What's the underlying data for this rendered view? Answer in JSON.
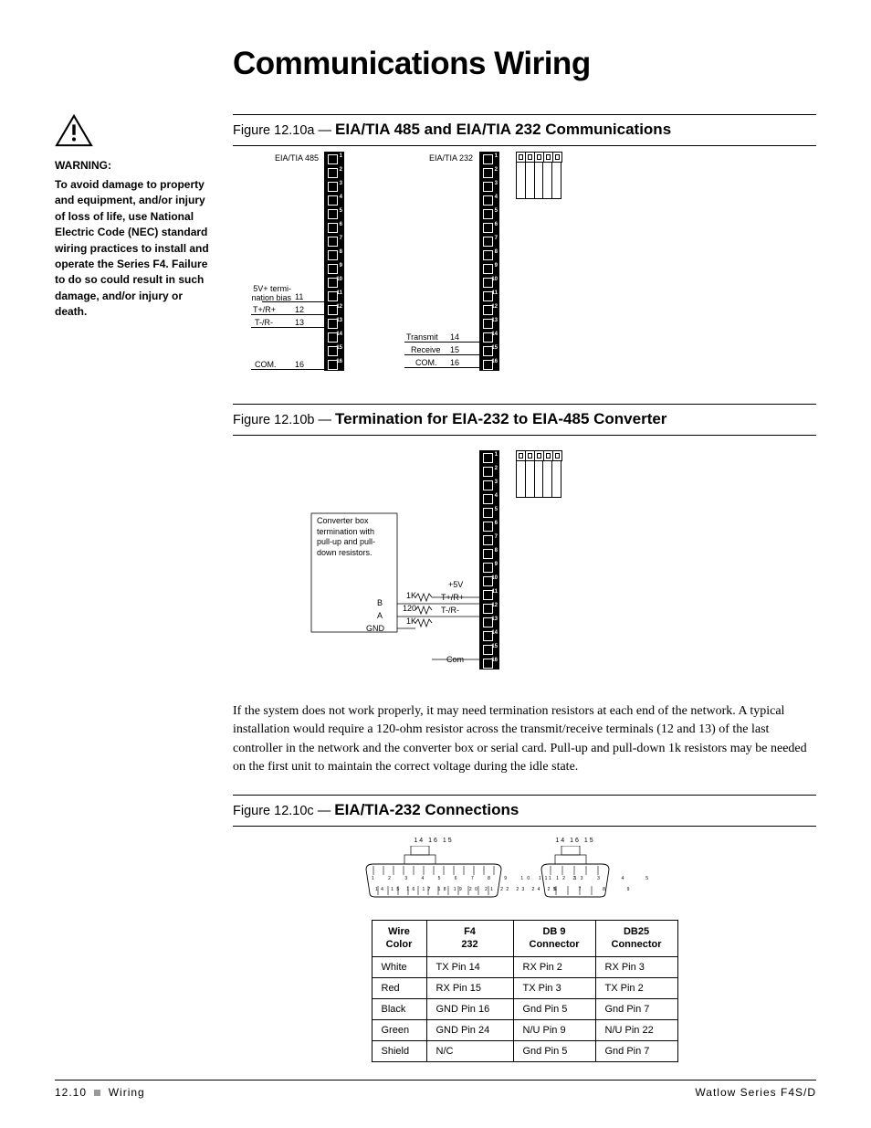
{
  "page_title": "Communications Wiring",
  "warning": {
    "heading": "WARNING:",
    "body": "To avoid damage to property and equipment, and/or injury of loss of life, use National Electric Code (NEC) standard wiring practices to install and operate the Series F4. Failure to do so could result in such damage, and/or injury or death."
  },
  "fig_a": {
    "prefix": "Figure 12.10a — ",
    "title": "EIA/TIA 485 and EIA/TIA 232 Communications",
    "left_header": "EIA/TIA 485",
    "right_header": "EIA/TIA 232",
    "labels_485": {
      "bias": "5V+ termi-\nnation bias",
      "bias_pin": "11",
      "tplus": "T+/R+",
      "tplus_pin": "12",
      "tminus": "T-/R-",
      "tminus_pin": "13",
      "com": "COM.",
      "com_pin": "16"
    },
    "labels_232": {
      "tx": "Transmit",
      "tx_pin": "14",
      "rx": "Receive",
      "rx_pin": "15",
      "com": "COM.",
      "com_pin": "16"
    }
  },
  "fig_b": {
    "prefix": "Figure 12.10b — ",
    "title": "Termination for EIA-232 to EIA-485 Converter",
    "note": "Converter box termination with pull-up and pull-down resistors.",
    "labels": {
      "b": "B",
      "a": "A",
      "gnd": "GND",
      "fivev": "+5V",
      "onek1": "1K",
      "onetwenty": "120",
      "onek2": "1K",
      "tplus": "T+/R+",
      "tminus": "T-/R-",
      "com": "Com"
    }
  },
  "body_para": "If the system does not work properly, it may need termination resistors at each end of the network. A typical installation would require a 120-ohm resistor across the transmit/receive terminals (12 and 13) of the last controller in the network and the converter box or serial card. Pull-up and pull-down 1k resistors may be needed on the first unit to maintain the correct voltage during the idle state.",
  "fig_c": {
    "prefix": "Figure 12.10c — ",
    "title": "EIA/TIA-232 Connections",
    "conn_top_a": "14  16  15",
    "conn_top_b": "14  16  15",
    "conn_pins_a_top": "1  2  3  4  5  6  7  8  9  10 11 12 13",
    "conn_pins_a_bot": "14 15 16 17 18 19 20 21 22 23 24 25",
    "conn_pins_b_top": "1  2  3  4  5",
    "conn_pins_b_bot": "6  7  8  9"
  },
  "table": {
    "headers": [
      "Wire\nColor",
      "F4\n232",
      "DB 9\nConnector",
      "DB25\nConnector"
    ],
    "rows": [
      [
        "White",
        "TX Pin 14",
        "RX Pin 2",
        "RX Pin 3"
      ],
      [
        "Red",
        "RX Pin 15",
        "TX Pin 3",
        "TX Pin 2"
      ],
      [
        "Black",
        "GND Pin 16",
        "Gnd Pin 5",
        "Gnd Pin 7"
      ],
      [
        "Green",
        "GND Pin 24",
        "N/U Pin 9",
        "N/U Pin 22"
      ],
      [
        "Shield",
        "N/C",
        "Gnd Pin 5",
        "Gnd Pin 7"
      ]
    ]
  },
  "footer": {
    "left_page": "12.10",
    "left_section": "Wiring",
    "right": "Watlow Series F4S/D"
  }
}
